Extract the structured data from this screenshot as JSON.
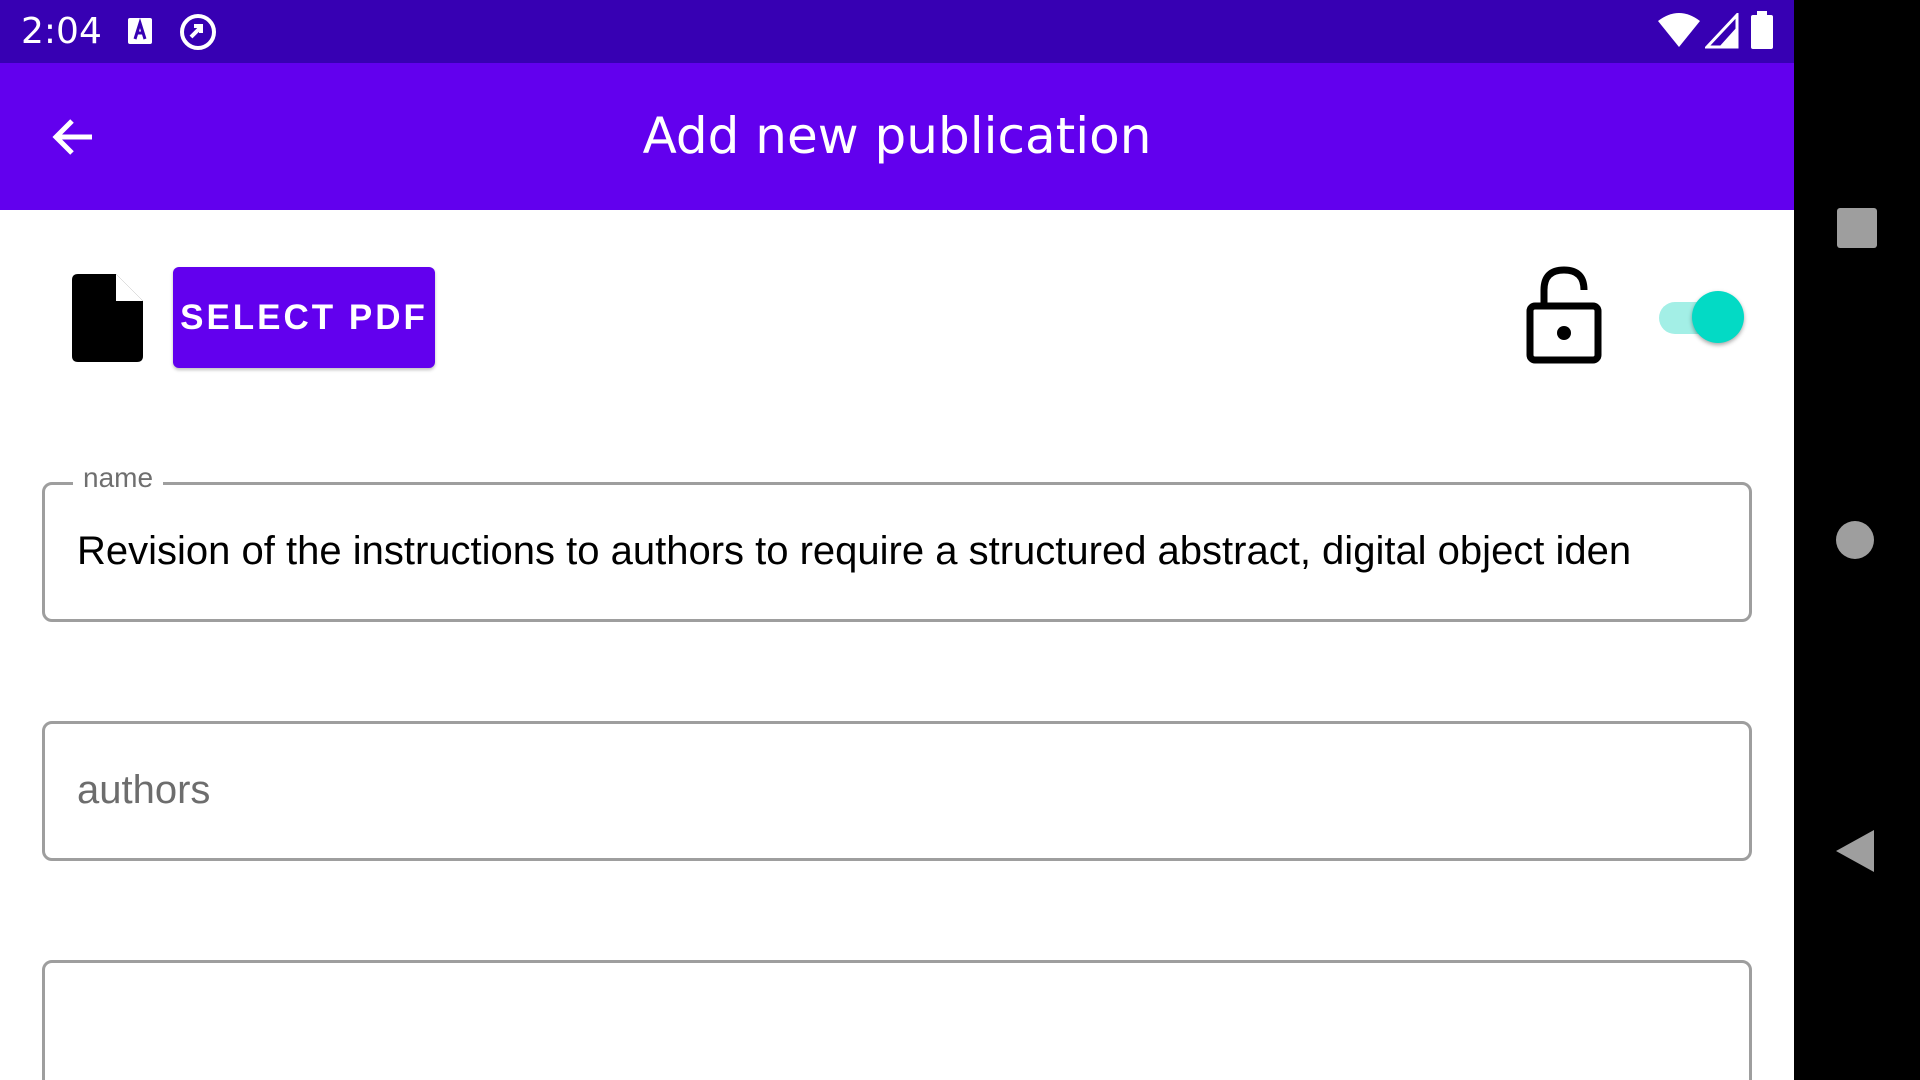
{
  "status_bar": {
    "time": "2:04",
    "icons": [
      "a-notification-icon",
      "sync-icon",
      "wifi-icon",
      "cell-signal-icon",
      "battery-icon"
    ],
    "background": "#3700b3"
  },
  "app_bar": {
    "title": "Add new publication",
    "back_icon": "arrow-back-icon",
    "background": "#6200ee"
  },
  "pdf_row": {
    "file_icon": "file-icon",
    "select_button_label": "SELECT PDF",
    "lock_icon": "lock-open-icon",
    "toggle_on": true,
    "toggle_color": "#03dac5"
  },
  "form": {
    "name": {
      "label": "name",
      "value": "Revision of the instructions to authors to require a structured abstract, digital object iden"
    },
    "authors": {
      "placeholder": "authors",
      "value": ""
    },
    "third": {
      "value": ""
    }
  },
  "nav_bar": {
    "buttons": [
      "recents-icon",
      "home-icon",
      "back-icon"
    ]
  }
}
